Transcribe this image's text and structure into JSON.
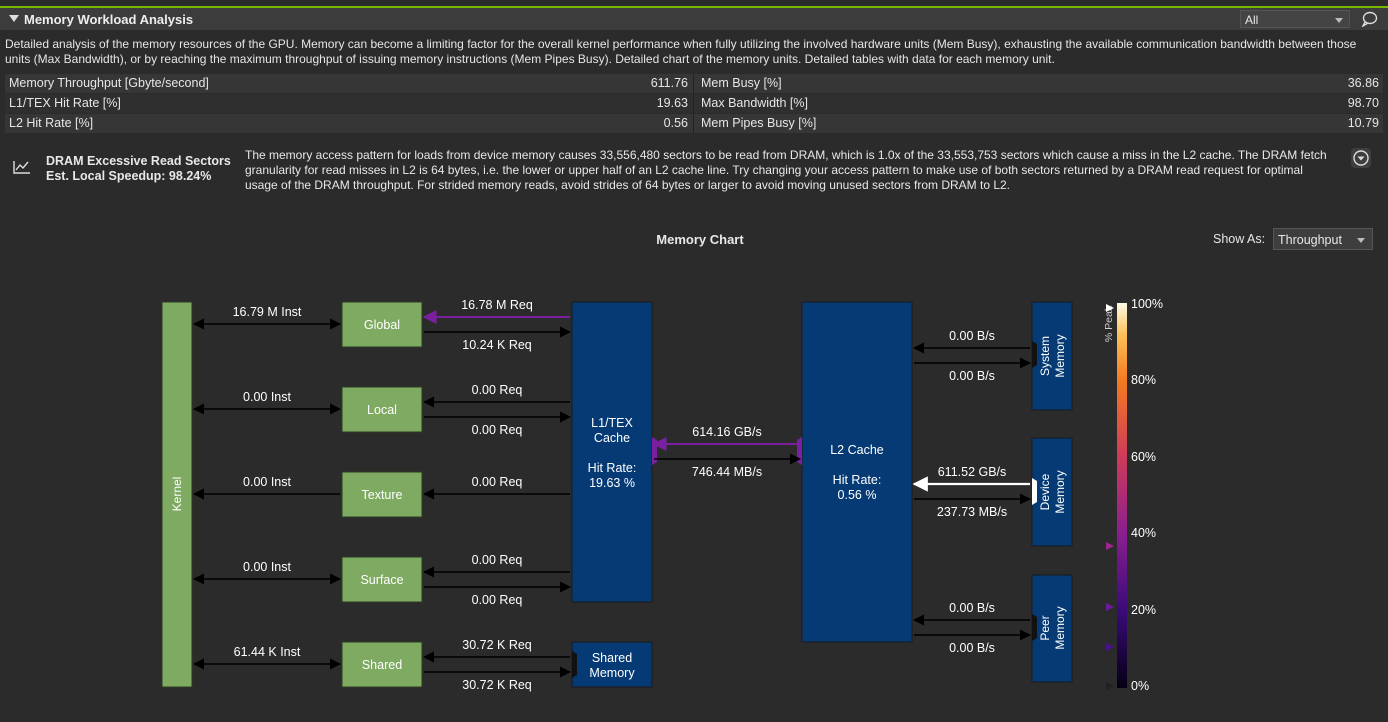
{
  "header": {
    "title": "Memory Workload Analysis",
    "filter_value": "All"
  },
  "description": "Detailed analysis of the memory resources of the GPU. Memory can become a limiting factor for the overall kernel performance when fully utilizing the involved hardware units (Mem Busy), exhausting the available communication bandwidth between those units (Max Bandwidth), or by reaching the maximum throughput of issuing memory instructions (Mem Pipes Busy). Detailed chart of the memory units. Detailed tables with data for each memory unit.",
  "metrics": [
    {
      "label1": "Memory Throughput [Gbyte/second]",
      "value1": "611.76",
      "label2": "Mem Busy [%]",
      "value2": "36.86"
    },
    {
      "label1": "L1/TEX Hit Rate [%]",
      "value1": "19.63",
      "label2": "Max Bandwidth [%]",
      "value2": "98.70"
    },
    {
      "label1": "L2 Hit Rate [%]",
      "value1": "0.56",
      "label2": "Mem Pipes Busy [%]",
      "value2": "10.79"
    }
  ],
  "rule": {
    "name": "DRAM Excessive Read Sectors",
    "speedup": "Est. Local Speedup: 98.24%",
    "text": "The memory access pattern for loads from device memory causes 33,556,480 sectors to be read from DRAM, which is 1.0x of the 33,553,753 sectors which cause a miss in the L2 cache. The DRAM fetch granularity for read misses in L2 is 64 bytes, i.e. the lower or upper half of an L2 cache line. Try changing your access pattern to make use of both sectors returned by a DRAM read request for optimal usage of the DRAM throughput. For strided memory reads, avoid strides of 64 bytes or larger to avoid moving unused sectors from DRAM to L2."
  },
  "chart": {
    "title": "Memory Chart",
    "show_as_label": "Show As:",
    "show_as_value": "Throughput",
    "kernel": "Kernel",
    "units": {
      "global": "Global",
      "local": "Local",
      "texture": "Texture",
      "surface": "Surface",
      "shared": "Shared"
    },
    "l1_name": [
      "L1/TEX",
      "Cache"
    ],
    "l1_hit": [
      "Hit Rate:",
      "19.63 %"
    ],
    "shared_mem": [
      "Shared",
      "Memory"
    ],
    "l2_name": "L2 Cache",
    "l2_hit": [
      "Hit Rate:",
      "0.56 %"
    ],
    "system_mem": [
      "System",
      "Memory"
    ],
    "device_mem": [
      "Device",
      "Memory"
    ],
    "peer_mem": [
      "Peer",
      "Memory"
    ],
    "inst": {
      "global": "16.79 M Inst",
      "local": "0.00 Inst",
      "texture": "0.00 Inst",
      "surface": "0.00 Inst",
      "shared": "61.44 K Inst"
    },
    "req": {
      "global_top": "16.78 M Req",
      "global_bottom": "10.24 K Req",
      "local_top": "0.00 Req",
      "local_bottom": "0.00 Req",
      "texture": "0.00 Req",
      "surface_top": "0.00 Req",
      "surface_bottom": "0.00 Req",
      "shared_top": "30.72 K Req",
      "shared_bottom": "30.72 K Req"
    },
    "l1_l2_top": "614.16 GB/s",
    "l1_l2_bottom": "746.44 MB/s",
    "system_top": "0.00 B/s",
    "system_bottom": "0.00 B/s",
    "device_top": "611.52 GB/s",
    "device_bottom": "237.73 MB/s",
    "peer_top": "0.00 B/s",
    "peer_bottom": "0.00 B/s",
    "legend_title": "% Peak",
    "legend_ticks": [
      "100%",
      "80%",
      "60%",
      "40%",
      "20%",
      "0%"
    ],
    "colors": {
      "unit_green": "#7eaa62",
      "cache_blue": "#053a75",
      "link_purple": "#7a1fa0",
      "link_white": "#ffffff",
      "accent_green": "#76b900"
    }
  }
}
